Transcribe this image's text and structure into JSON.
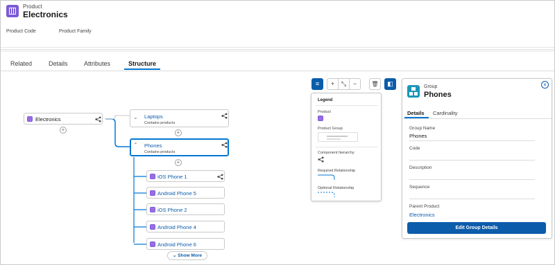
{
  "header": {
    "object_type": "Product",
    "title": "Electronics",
    "fields": [
      "Product Code",
      "Product Family"
    ]
  },
  "tabs": [
    {
      "label": "Related"
    },
    {
      "label": "Details"
    },
    {
      "label": "Attributes"
    },
    {
      "label": "Structure",
      "active": true
    }
  ],
  "tree": {
    "root": {
      "label": "Electronics"
    },
    "groups": [
      {
        "label": "Laptops",
        "sub": "Contains products",
        "expanded": false
      },
      {
        "label": "Phones",
        "sub": "Contains products",
        "expanded": true,
        "selected": true
      }
    ],
    "children": [
      "iOS Phone 1",
      "Android Phone 5",
      "iOS Phone 2",
      "Android Phone 4",
      "Android Phone 6"
    ],
    "show_more": "Show More"
  },
  "legend": {
    "title": "Legend",
    "items": [
      "Product",
      "Product Group",
      "Component hierarchy",
      "Required Relationship",
      "Optional Relationship"
    ]
  },
  "panel": {
    "type": "Group",
    "title": "Phones",
    "tabs": [
      {
        "label": "Details",
        "active": true
      },
      {
        "label": "Cardinality"
      }
    ],
    "fields": [
      {
        "label": "Group Name",
        "value": "Phones"
      },
      {
        "label": "Code",
        "value": ""
      },
      {
        "label": "Description",
        "value": ""
      },
      {
        "label": "Sequence",
        "value": ""
      },
      {
        "label": "Parent Product",
        "value": "Electronics",
        "link": true
      }
    ],
    "button": "Edit Group Details"
  },
  "colors": {
    "brand": "#0b5cab",
    "product_icon": "#9b6ce6",
    "group_icon": "#1b96b8"
  }
}
